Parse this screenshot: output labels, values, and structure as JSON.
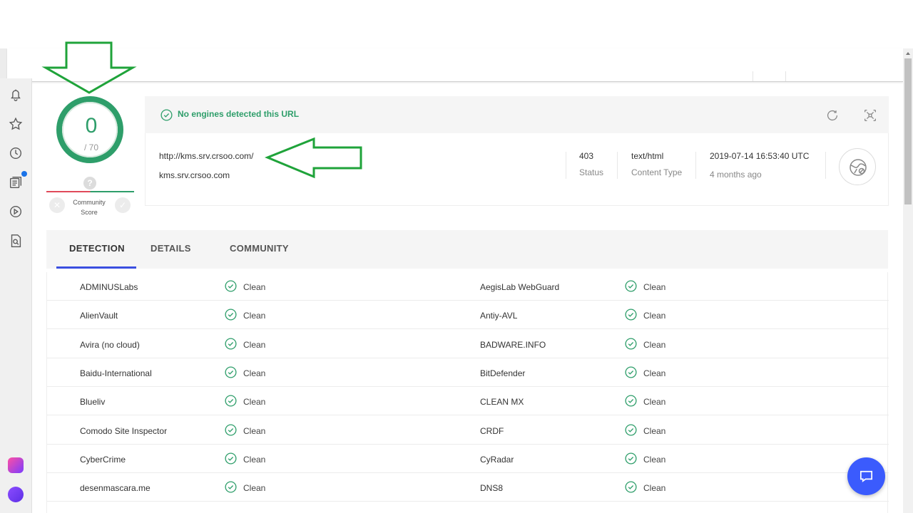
{
  "score": {
    "detected": "0",
    "total": "/ 70",
    "community_unknown": "?",
    "community_label_line1": "Community",
    "community_label_line2": "Score",
    "vote_down": "✕",
    "vote_up": "✓"
  },
  "banner": {
    "message": "No engines detected this URL"
  },
  "info": {
    "url": "http://kms.srv.crsoo.com/",
    "host": "kms.srv.crsoo.com",
    "status_value": "403",
    "status_label": "Status",
    "content_type_value": "text/html",
    "content_type_label": "Content Type",
    "date_value": "2019-07-14 16:53:40 UTC",
    "date_relative": "4 months ago"
  },
  "tabs": [
    {
      "label": "DETECTION"
    },
    {
      "label": "DETAILS"
    },
    {
      "label": "COMMUNITY"
    }
  ],
  "detections": [
    {
      "left_engine": "ADMINUSLabs",
      "left_result": "Clean",
      "right_engine": "AegisLab WebGuard",
      "right_result": "Clean"
    },
    {
      "left_engine": "AlienVault",
      "left_result": "Clean",
      "right_engine": "Antiy-AVL",
      "right_result": "Clean"
    },
    {
      "left_engine": "Avira (no cloud)",
      "left_result": "Clean",
      "right_engine": "BADWARE.INFO",
      "right_result": "Clean"
    },
    {
      "left_engine": "Baidu-International",
      "left_result": "Clean",
      "right_engine": "BitDefender",
      "right_result": "Clean"
    },
    {
      "left_engine": "Blueliv",
      "left_result": "Clean",
      "right_engine": "CLEAN MX",
      "right_result": "Clean"
    },
    {
      "left_engine": "Comodo Site Inspector",
      "left_result": "Clean",
      "right_engine": "CRDF",
      "right_result": "Clean"
    },
    {
      "left_engine": "CyberCrime",
      "left_result": "Clean",
      "right_engine": "CyRadar",
      "right_result": "Clean"
    },
    {
      "left_engine": "desenmascara.me",
      "left_result": "Clean",
      "right_engine": "DNS8",
      "right_result": "Clean"
    }
  ],
  "colors": {
    "clean_green": "#2e9e6a",
    "tab_active": "#3b4fe0",
    "annotation_green": "#1fa33a",
    "fab_blue": "#3b5bfd"
  },
  "icons": {
    "sidebar": [
      "bell-icon",
      "star-icon",
      "clock-icon",
      "news-icon",
      "play-icon",
      "search-doc-icon"
    ],
    "banner": [
      "refresh-icon",
      "graph-icon"
    ]
  }
}
